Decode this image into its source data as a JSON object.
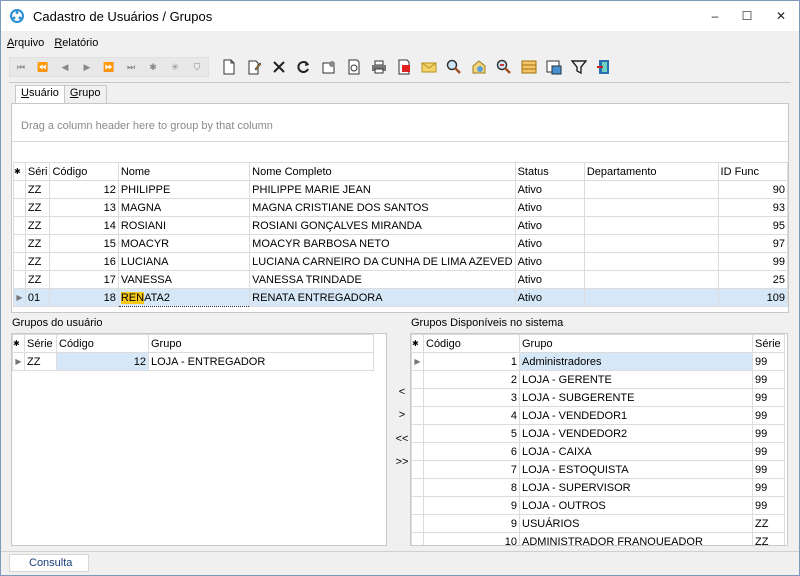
{
  "window": {
    "title": "Cadastro de Usuários / Grupos",
    "controls": {
      "minimize": "–",
      "maximize": "☐",
      "close": "✕"
    }
  },
  "menu": {
    "items": [
      {
        "underline": "A",
        "rest": "rquivo"
      },
      {
        "underline": "R",
        "rest": "elatório"
      }
    ]
  },
  "toolbar": {
    "nav_icons": [
      "first-record-icon",
      "prev-page-icon",
      "prev-record-icon",
      "next-record-icon",
      "next-page-icon",
      "last-record-icon",
      "insert-record-icon",
      "edit-record-icon",
      "filter-record-icon"
    ],
    "nav_glyphs": [
      "⏮",
      "⏪",
      "◀",
      "▶",
      "⏩",
      "⏭",
      "✱",
      "✳",
      "⛉"
    ],
    "buttons": [
      "new-document",
      "edit-document",
      "delete",
      "refresh",
      "properties",
      "print-preview",
      "print",
      "pdf-export",
      "email",
      "search",
      "search-web",
      "zoom-out",
      "spreadsheet",
      "import",
      "filter",
      "exit"
    ]
  },
  "tabs": [
    {
      "label_u": "U",
      "label_rest": "suário",
      "active": true
    },
    {
      "label_u": "G",
      "label_rest": "rupo",
      "active": false
    }
  ],
  "users": {
    "group_hint": "Drag a column header here to group by that column",
    "headers": [
      "Séri",
      "Código",
      "Nome",
      "Nome Completo",
      "Status",
      "Departamento",
      "ID Func"
    ],
    "rows": [
      {
        "serie": "ZZ",
        "codigo": "12",
        "nome": "PHILIPPE",
        "completo": "PHILIPPE MARIE JEAN",
        "status": "Ativo",
        "depto": "",
        "idfunc": "90"
      },
      {
        "serie": "ZZ",
        "codigo": "13",
        "nome": "MAGNA",
        "completo": "MAGNA CRISTIANE DOS SANTOS",
        "status": "Ativo",
        "depto": "",
        "idfunc": "93"
      },
      {
        "serie": "ZZ",
        "codigo": "14",
        "nome": "ROSIANI",
        "completo": "ROSIANI GONÇALVES MIRANDA",
        "status": "Ativo",
        "depto": "",
        "idfunc": "95"
      },
      {
        "serie": "ZZ",
        "codigo": "15",
        "nome": "MOACYR",
        "completo": "MOACYR BARBOSA NETO",
        "status": "Ativo",
        "depto": "",
        "idfunc": "97"
      },
      {
        "serie": "ZZ",
        "codigo": "16",
        "nome": "LUCIANA",
        "completo": "LUCIANA CARNEIRO DA CUNHA DE LIMA AZEVED",
        "status": "Ativo",
        "depto": "",
        "idfunc": "99"
      },
      {
        "serie": "ZZ",
        "codigo": "17",
        "nome": "VANESSA",
        "completo": "VANESSA TRINDADE",
        "status": "Ativo",
        "depto": "",
        "idfunc": "25"
      }
    ],
    "selected_row": {
      "serie": "01",
      "codigo": "18",
      "nome_hl": "REN",
      "nome_rest": "ATA2",
      "completo": "RENATA ENTREGADORA",
      "status": "Ativo",
      "depto": "",
      "idfunc": "109"
    }
  },
  "user_groups": {
    "label": "Grupos do usuário",
    "headers": [
      "Série",
      "Código",
      "Grupo"
    ],
    "rows": [
      {
        "serie": "ZZ",
        "codigo": "12",
        "grupo": "LOJA - ENTREGADOR"
      }
    ]
  },
  "transfer": {
    "add_one": "<",
    "remove_one": ">",
    "add_all": "<<",
    "remove_all": ">>"
  },
  "available_groups": {
    "label": "Grupos Disponíveis no sistema",
    "headers": [
      "Código",
      "Grupo",
      "Série"
    ],
    "rows": [
      {
        "codigo": "1",
        "grupo": "Administradores",
        "serie": "99"
      },
      {
        "codigo": "2",
        "grupo": "LOJA - GERENTE",
        "serie": "99"
      },
      {
        "codigo": "3",
        "grupo": "LOJA - SUBGERENTE",
        "serie": "99"
      },
      {
        "codigo": "4",
        "grupo": "LOJA - VENDEDOR1",
        "serie": "99"
      },
      {
        "codigo": "5",
        "grupo": "LOJA - VENDEDOR2",
        "serie": "99"
      },
      {
        "codigo": "6",
        "grupo": "LOJA - CAIXA",
        "serie": "99"
      },
      {
        "codigo": "7",
        "grupo": "LOJA - ESTOQUISTA",
        "serie": "99"
      },
      {
        "codigo": "8",
        "grupo": "LOJA - SUPERVISOR",
        "serie": "99"
      },
      {
        "codigo": "9",
        "grupo": "LOJA - OUTROS",
        "serie": "99"
      },
      {
        "codigo": "9",
        "grupo": "USUÁRIOS",
        "serie": "ZZ"
      },
      {
        "codigo": "10",
        "grupo": "ADMINISTRADOR FRANQUEADOR",
        "serie": "ZZ"
      }
    ]
  },
  "status": {
    "tab": "Consulta"
  },
  "colors": {
    "selection": "#d6e8f8",
    "highlight": "#f5c518",
    "link": "#1a3f7a"
  }
}
